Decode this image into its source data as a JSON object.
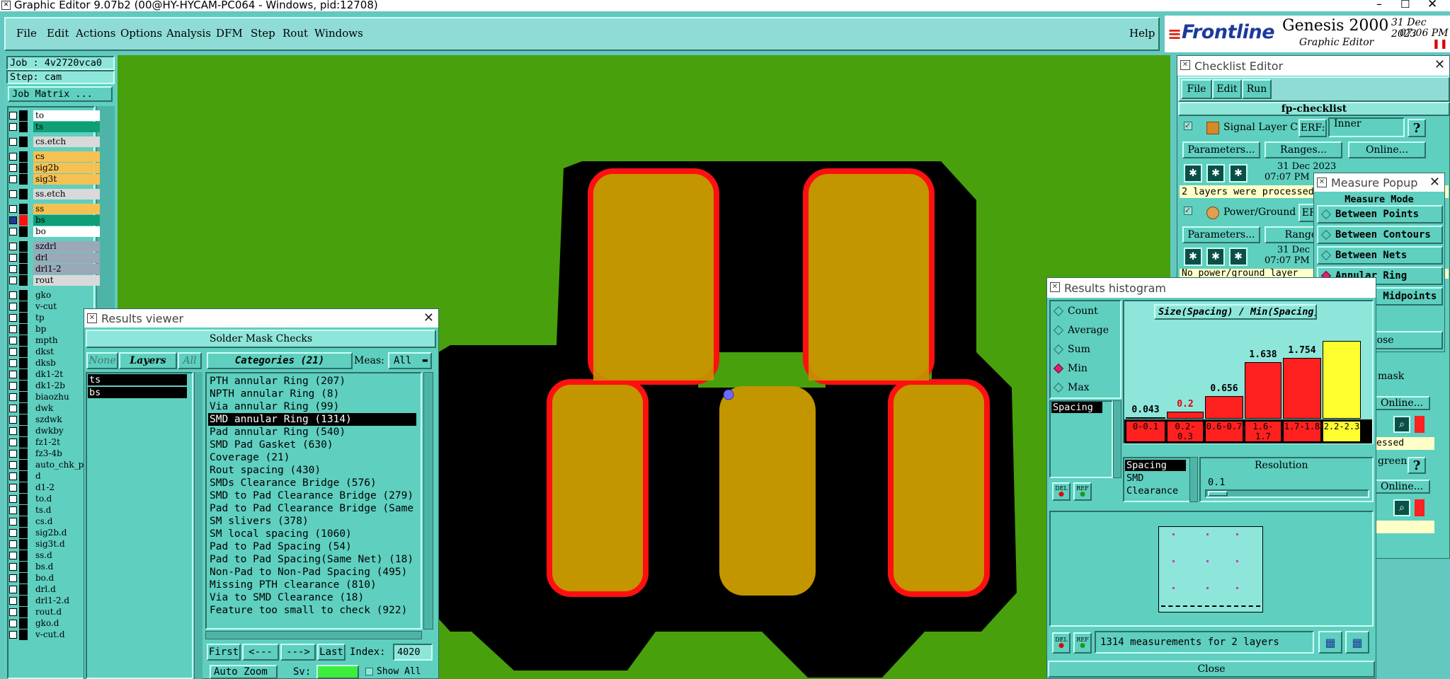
{
  "titlebar": {
    "title": "Graphic Editor 9.07b2 (00@HY-HYCAM-PC064 - Windows, pid:12708)"
  },
  "menu": {
    "items": [
      "File",
      "Edit",
      "Actions",
      "Options",
      "Analysis",
      "DFM",
      "Step",
      "Rout",
      "Windows"
    ],
    "help": "Help"
  },
  "brand": {
    "logo": "Frontline",
    "product": "Genesis 2000",
    "subtitle": "Graphic Editor",
    "date": "31 Dec 2023",
    "time": "07:06 PM"
  },
  "job": {
    "job": "Job : 4v2720vca0",
    "step": "Step: cam",
    "matrix": "Job Matrix ..."
  },
  "layers": [
    {
      "name": "to",
      "color": "#ffffff"
    },
    {
      "name": "ts",
      "color": "#0f9f76"
    },
    {
      "name": "cs.etch",
      "color": "#d9d9d9"
    },
    {
      "name": "cs",
      "color": "#f5c153"
    },
    {
      "name": "sig2b",
      "color": "#f5c153"
    },
    {
      "name": "sig3t",
      "color": "#f5c153"
    },
    {
      "name": "ss.etch",
      "color": "#d9d9d9"
    },
    {
      "name": "ss",
      "color": "#f5c153"
    },
    {
      "name": "bs",
      "color": "#0f9f76"
    },
    {
      "name": "bo",
      "color": "#ffffff"
    },
    {
      "name": "szdrl",
      "color": "#9aa8b8"
    },
    {
      "name": "drl",
      "color": "#9aa8b8"
    },
    {
      "name": "drl1-2",
      "color": "#9aa8b8"
    },
    {
      "name": "rout",
      "color": "#d9d9d9"
    },
    {
      "name": "gko"
    },
    {
      "name": "v-cut"
    },
    {
      "name": "tp"
    },
    {
      "name": "bp"
    },
    {
      "name": "mpth"
    },
    {
      "name": "dkst"
    },
    {
      "name": "dksb"
    },
    {
      "name": "dk1-2t"
    },
    {
      "name": "dk1-2b"
    },
    {
      "name": "biaozhu"
    },
    {
      "name": "dwk"
    },
    {
      "name": "szdwk"
    },
    {
      "name": "dwkby"
    },
    {
      "name": "fz1-2t"
    },
    {
      "name": "fz3-4b"
    },
    {
      "name": "auto_chk_p"
    },
    {
      "name": "d"
    },
    {
      "name": "d1-2"
    },
    {
      "name": "to.d"
    },
    {
      "name": "ts.d"
    },
    {
      "name": "cs.d"
    },
    {
      "name": "sig2b.d"
    },
    {
      "name": "sig3t.d"
    },
    {
      "name": "ss.d"
    },
    {
      "name": "bs.d"
    },
    {
      "name": "bo.d"
    },
    {
      "name": "drl.d"
    },
    {
      "name": "drl1-2.d"
    },
    {
      "name": "rout.d"
    },
    {
      "name": "gko.d"
    },
    {
      "name": "v-cut.d"
    }
  ],
  "results_viewer": {
    "title": "Results viewer",
    "header": "Solder Mask Checks",
    "none": "None",
    "layers_label": "Layers",
    "all": "All",
    "categories_label": "Categories (21)",
    "meas_label": "Meas:",
    "meas_value": "All",
    "layer_list": [
      "ts",
      "bs"
    ],
    "categories": [
      "PTH annular Ring (207)",
      "NPTH annular Ring (8)",
      "Via annular Ring (99)",
      "SMD annular Ring (1314)",
      "Pad annular Ring (540)",
      "SMD Pad Gasket (630)",
      "Coverage (21)",
      "Rout spacing (430)",
      "SMDs Clearance Bridge (576)",
      "SMD to Pad Clearance Bridge (279)",
      "Pad to Pad Clearance Bridge (Same",
      "SM slivers (378)",
      "SM local spacing (1060)",
      "Pad to Pad Spacing (54)",
      "Pad to Pad Spacing(Same Net) (18)",
      "Non-Pad to Non-Pad Spacing (495)",
      "Missing PTH clearance (810)",
      "Via to SMD Clearance (18)",
      "Feature too small to check (922)"
    ],
    "selected_index": 3,
    "nav": {
      "first": "First",
      "prev": "<---",
      "next": "--->",
      "last": "Last",
      "index_label": "Index:",
      "index_value": "4020"
    },
    "auto_zoom": "Auto Zoom",
    "sv_label": "Sv:",
    "show_all": "Show All"
  },
  "checklist": {
    "title": "Checklist Editor",
    "menu": [
      "File",
      "Edit",
      "Run"
    ],
    "name": "fp-checklist",
    "rows": [
      {
        "label": "Signal Layer Ch",
        "erf": "ERF:",
        "erf_value": "Inner",
        "help": "?",
        "params": "Parameters...",
        "ranges": "Ranges...",
        "online": "Online...",
        "date": "31 Dec 2023",
        "time": "07:07 PM",
        "status": "2 layers were processed"
      },
      {
        "label": "Power/Ground C",
        "erf": "ERF",
        "params": "Parameters...",
        "ranges": "Ranges",
        "date": "31 Dec",
        "time": "07:07 PM",
        "status": "No power/ground layer"
      }
    ],
    "peek": {
      "mask": "mask",
      "online": "Online...",
      "essed": "essed",
      "green": "green",
      "online2": "Online...",
      "help": "?"
    }
  },
  "measure": {
    "title": "Measure Popup",
    "mode_label": "Measure Mode",
    "items": [
      "Between Points",
      "Between Contours",
      "Between Nets",
      "Annular Ring",
      "Between Midpoints"
    ],
    "selected": "Annular Ring",
    "close": "Close"
  },
  "histogram": {
    "title": "Results histogram",
    "options": [
      "Count",
      "Average",
      "Sum",
      "Min",
      "Max"
    ],
    "selected": "Min",
    "chart_title": "Size(Spacing) / Min(Spacing)",
    "list_item": "Spacing",
    "del": "DEL",
    "ref": "REF",
    "res_list": [
      "Spacing",
      "SMD",
      "Clearance"
    ],
    "resolution_label": "Resolution",
    "resolution_value": "0.1",
    "footer_text": "1314 measurements for 2 layers",
    "close": "Close"
  },
  "chart_data": {
    "type": "bar",
    "title": "Size(Spacing) / Min(Spacing)",
    "categories": [
      "0-0.1",
      "0.2-0.3",
      "0.6-0.7",
      "1.6-1.7",
      "1.7-1.8",
      "2.2-2.3"
    ],
    "value_labels": [
      "0.043",
      "0.2",
      "0.656",
      "1.638",
      "1.754",
      ""
    ],
    "values": [
      0.043,
      0.2,
      0.656,
      1.638,
      1.754,
      2.25
    ],
    "colors": [
      "#ff2020",
      "#ff2020",
      "#ff2020",
      "#ff2020",
      "#ff2020",
      "#ffff30"
    ]
  }
}
